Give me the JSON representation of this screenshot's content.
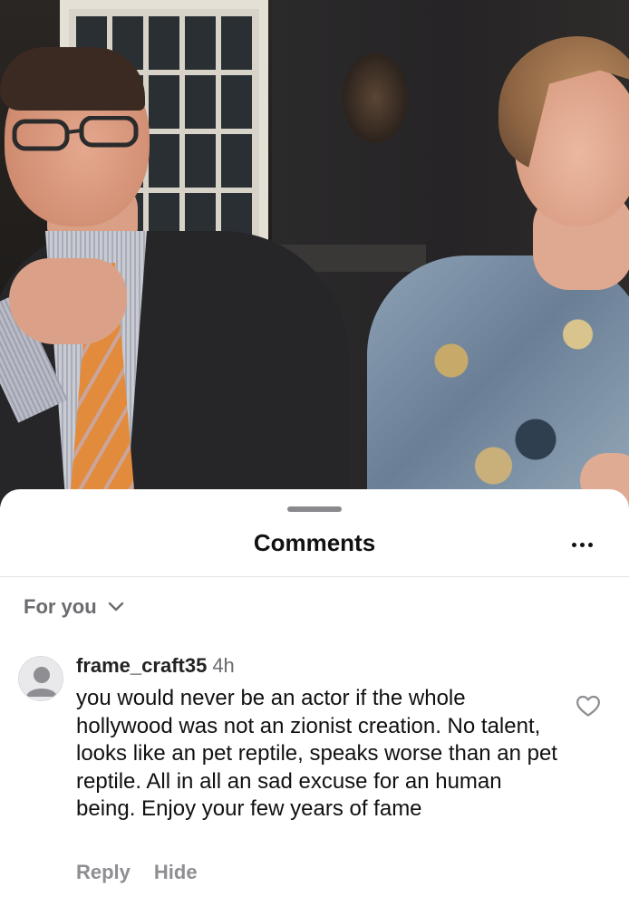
{
  "video": {
    "description_icon": "video-frame"
  },
  "sheet": {
    "title": "Comments",
    "more_icon": "more-horizontal-icon"
  },
  "sort": {
    "label": "For you",
    "icon": "chevron-down-icon"
  },
  "comments": [
    {
      "username": "frame_craft35",
      "timestamp": "4h",
      "text": "you would never be an actor if the whole hollywood was not an zionist creation. No talent, looks like an pet reptile, speaks worse than an pet reptile. All in all an sad excuse for an human being. Enjoy your few years of fame",
      "reply_label": "Reply",
      "hide_label": "Hide",
      "avatar_icon": "default-avatar-icon",
      "like_icon": "heart-outline-icon"
    }
  ],
  "colors": {
    "background": "#ffffff",
    "title_text": "#111111",
    "secondary_text": "#6b6b70",
    "action_text": "#8e8e93",
    "divider": "#e3e3e6",
    "grabber": "#8a8a8e"
  }
}
